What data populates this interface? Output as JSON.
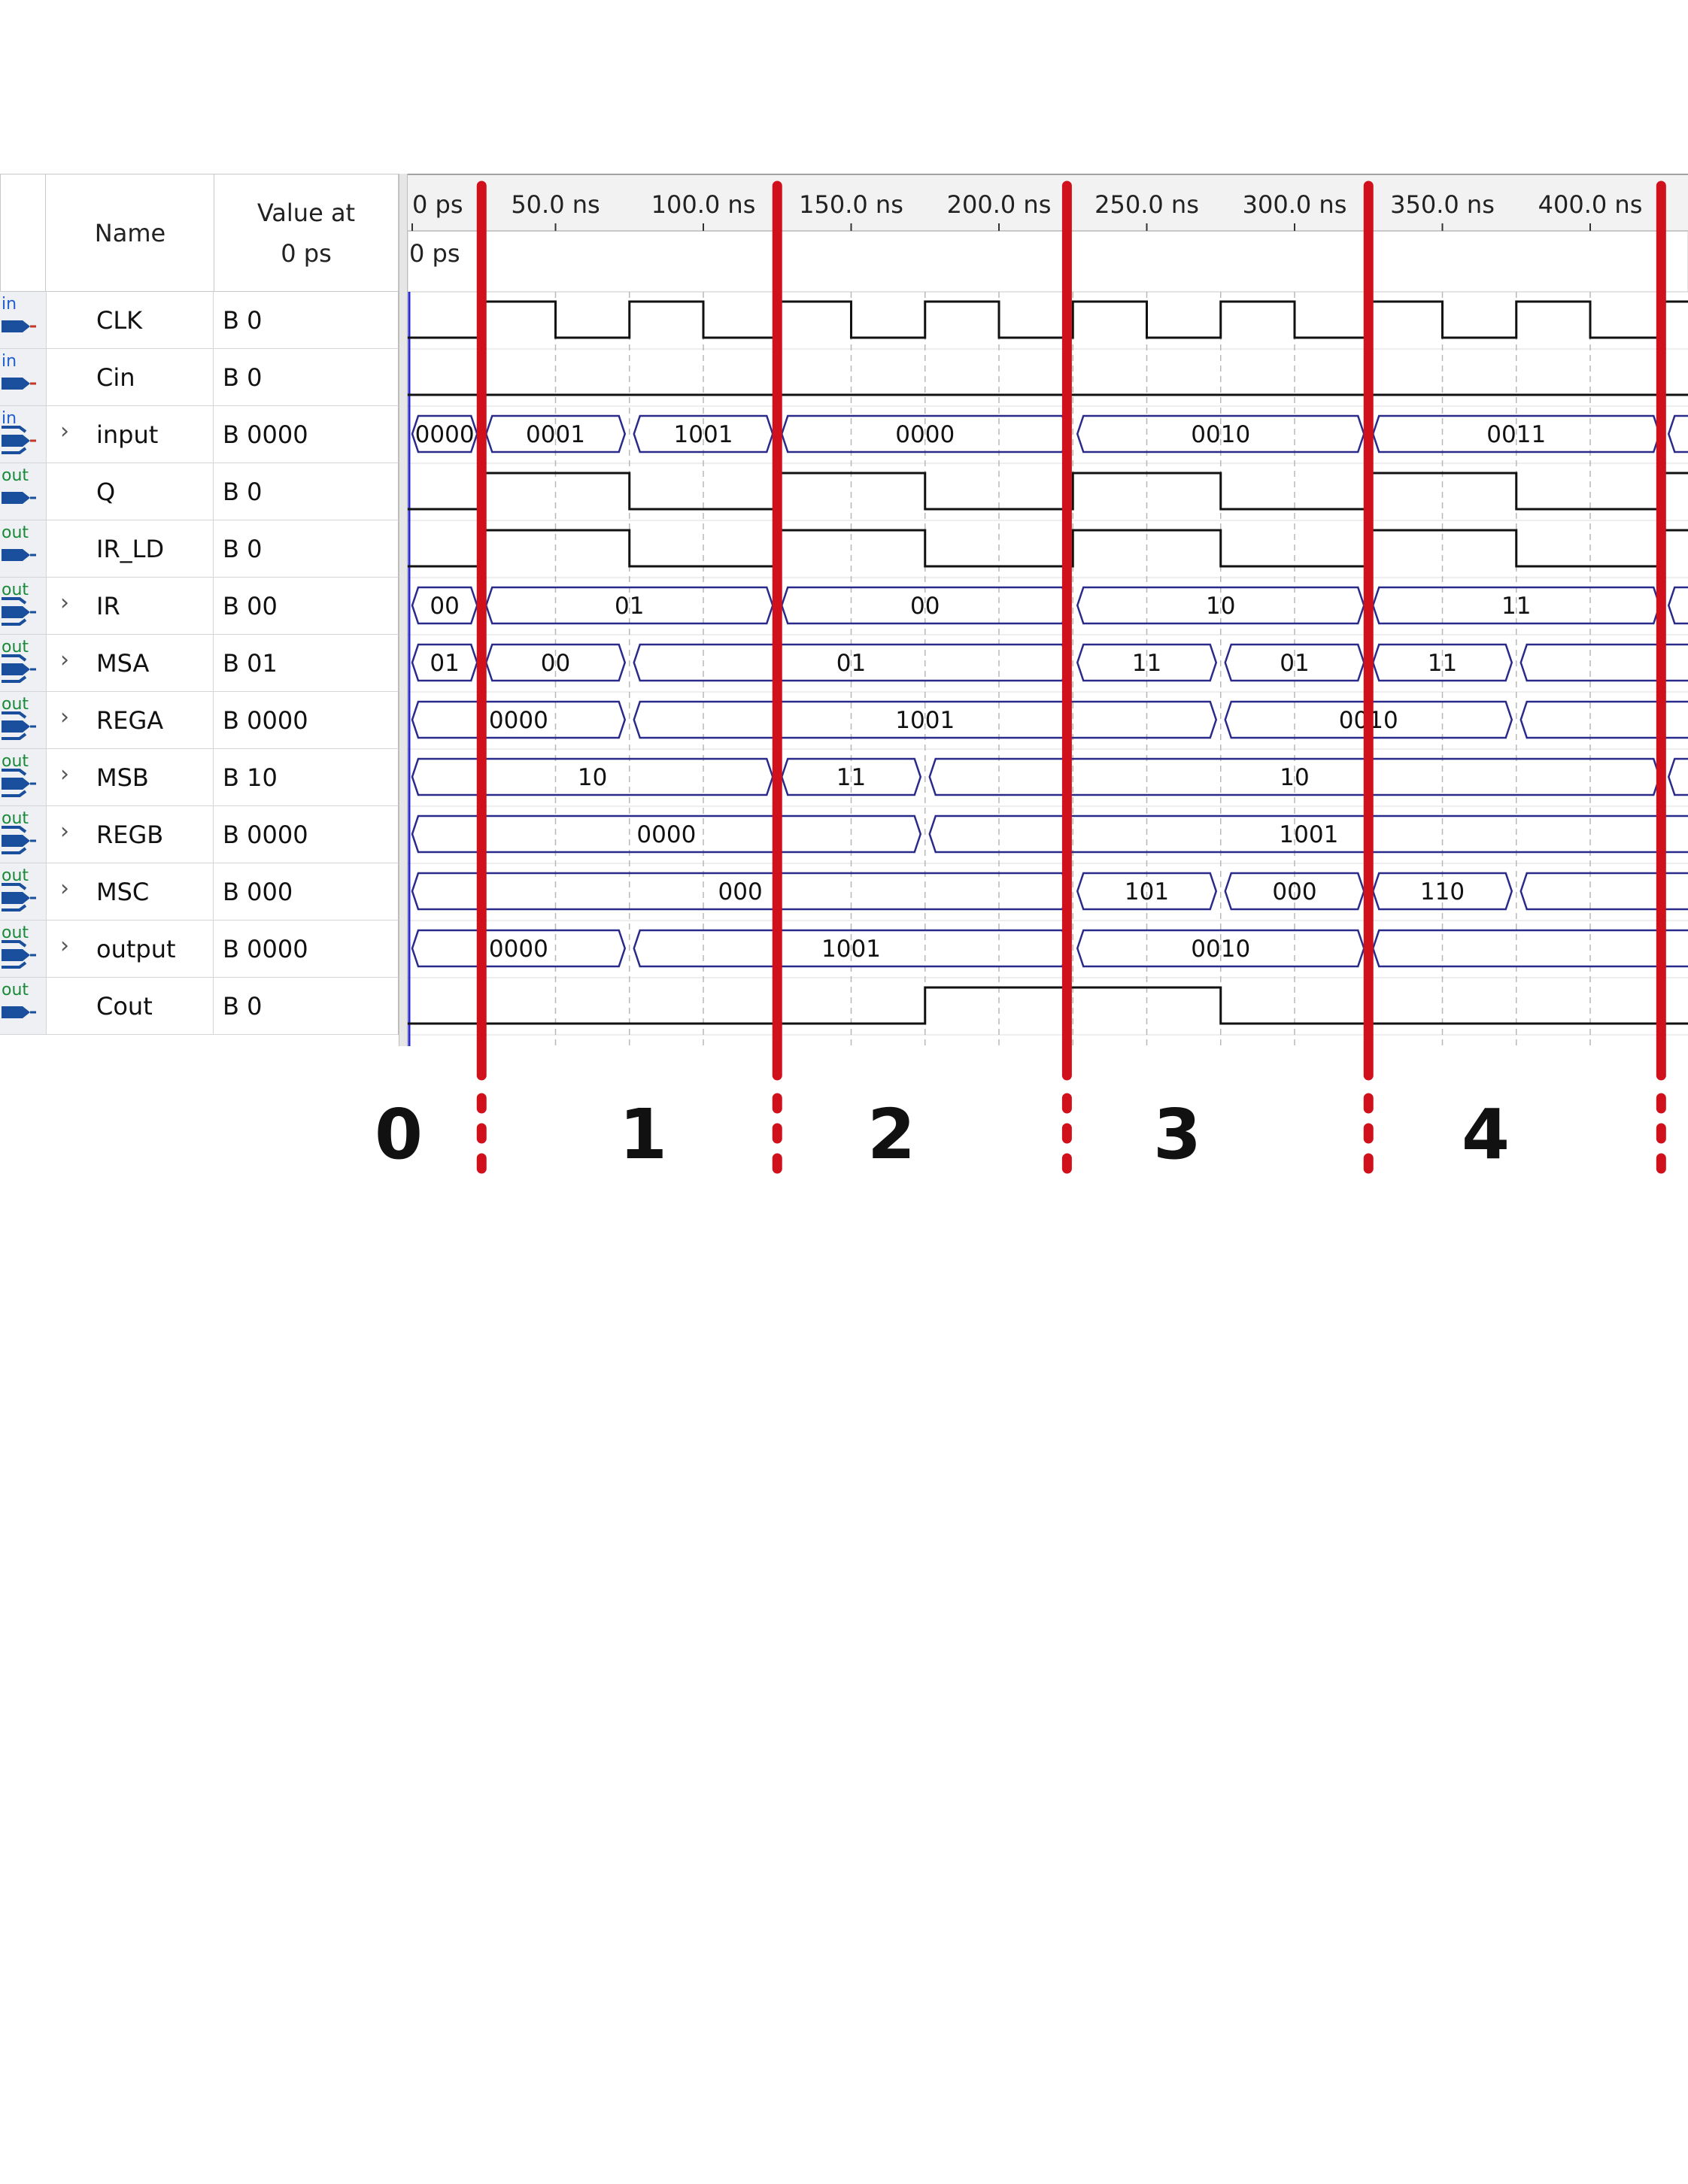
{
  "header": {
    "name_label": "Name",
    "value_label_line1": "Value at",
    "value_label_line2": "0 ps",
    "cursor_label": "0 ps"
  },
  "timeline": {
    "ticks": [
      "0 ps",
      "50.0 ns",
      "100.0 ns",
      "150.0 ns",
      "200.0 ns",
      "250.0 ns",
      "300.0 ns",
      "350.0 ns",
      "400.0 ns"
    ],
    "tick_ns": [
      0,
      50,
      100,
      150,
      200,
      250,
      300,
      350,
      400
    ]
  },
  "signals": [
    {
      "dir": "in",
      "name": "CLK",
      "value": "B 0",
      "expand": false,
      "icon": "input-pin-icon"
    },
    {
      "dir": "in",
      "name": "Cin",
      "value": "B 0",
      "expand": false,
      "icon": "input-pin-icon"
    },
    {
      "dir": "in",
      "name": "input",
      "value": "B 0000",
      "expand": true,
      "icon": "input-bus-icon"
    },
    {
      "dir": "out",
      "name": "Q",
      "value": "B 0",
      "expand": false,
      "icon": "output-pin-icon"
    },
    {
      "dir": "out",
      "name": "IR_LD",
      "value": "B 0",
      "expand": false,
      "icon": "output-pin-icon"
    },
    {
      "dir": "out",
      "name": "IR",
      "value": "B 00",
      "expand": true,
      "icon": "output-bus-icon"
    },
    {
      "dir": "out",
      "name": "MSA",
      "value": "B 01",
      "expand": true,
      "icon": "output-bus-icon"
    },
    {
      "dir": "out",
      "name": "REGA",
      "value": "B 0000",
      "expand": true,
      "icon": "output-bus-icon"
    },
    {
      "dir": "out",
      "name": "MSB",
      "value": "B 10",
      "expand": true,
      "icon": "output-bus-icon"
    },
    {
      "dir": "out",
      "name": "REGB",
      "value": "B 0000",
      "expand": true,
      "icon": "output-bus-icon"
    },
    {
      "dir": "out",
      "name": "MSC",
      "value": "B 000",
      "expand": true,
      "icon": "output-bus-icon"
    },
    {
      "dir": "out",
      "name": "output",
      "value": "B 0000",
      "expand": true,
      "icon": "output-bus-icon"
    },
    {
      "dir": "out",
      "name": "Cout",
      "value": "B 0",
      "expand": false,
      "icon": "output-pin-icon"
    }
  ],
  "waves": {
    "CLK": {
      "type": "bit",
      "edges": [
        [
          0,
          0
        ],
        [
          25,
          1
        ],
        [
          50,
          0
        ],
        [
          75,
          1
        ],
        [
          100,
          0
        ],
        [
          125,
          1
        ],
        [
          150,
          0
        ],
        [
          175,
          1
        ],
        [
          200,
          0
        ],
        [
          225,
          1
        ],
        [
          250,
          0
        ],
        [
          275,
          1
        ],
        [
          300,
          0
        ],
        [
          325,
          1
        ],
        [
          350,
          0
        ],
        [
          375,
          1
        ],
        [
          400,
          0
        ],
        [
          425,
          1
        ]
      ]
    },
    "Cin": {
      "type": "bit",
      "edges": [
        [
          0,
          0
        ]
      ]
    },
    "input": {
      "type": "bus",
      "segments": [
        [
          0,
          25,
          "0000"
        ],
        [
          25,
          75,
          "0001"
        ],
        [
          75,
          125,
          "1001"
        ],
        [
          125,
          225,
          "0000"
        ],
        [
          225,
          325,
          "0010"
        ],
        [
          325,
          425,
          "0011"
        ],
        [
          425,
          440,
          ""
        ]
      ]
    },
    "Q": {
      "type": "bit",
      "edges": [
        [
          0,
          0
        ],
        [
          25,
          1
        ],
        [
          75,
          0
        ],
        [
          125,
          1
        ],
        [
          175,
          0
        ],
        [
          225,
          1
        ],
        [
          275,
          0
        ],
        [
          325,
          1
        ],
        [
          375,
          0
        ],
        [
          425,
          1
        ]
      ]
    },
    "IR_LD": {
      "type": "bit",
      "edges": [
        [
          0,
          0
        ],
        [
          25,
          1
        ],
        [
          75,
          0
        ],
        [
          125,
          1
        ],
        [
          175,
          0
        ],
        [
          225,
          1
        ],
        [
          275,
          0
        ],
        [
          325,
          1
        ],
        [
          375,
          0
        ],
        [
          425,
          1
        ]
      ]
    },
    "IR": {
      "type": "bus",
      "segments": [
        [
          0,
          25,
          "00"
        ],
        [
          25,
          125,
          "01"
        ],
        [
          125,
          225,
          "00"
        ],
        [
          225,
          325,
          "10"
        ],
        [
          325,
          425,
          "11"
        ],
        [
          425,
          440,
          ""
        ]
      ]
    },
    "MSA": {
      "type": "bus",
      "segments": [
        [
          0,
          25,
          "01"
        ],
        [
          25,
          75,
          "00"
        ],
        [
          75,
          225,
          "01"
        ],
        [
          225,
          275,
          "11"
        ],
        [
          275,
          325,
          "01"
        ],
        [
          325,
          375,
          "11"
        ],
        [
          375,
          440,
          ""
        ]
      ]
    },
    "REGA": {
      "type": "bus",
      "segments": [
        [
          0,
          75,
          "0000"
        ],
        [
          75,
          275,
          "1001"
        ],
        [
          275,
          375,
          "0010"
        ],
        [
          375,
          440,
          ""
        ]
      ]
    },
    "MSB": {
      "type": "bus",
      "segments": [
        [
          0,
          125,
          "10"
        ],
        [
          125,
          175,
          "11"
        ],
        [
          175,
          425,
          "10"
        ],
        [
          425,
          440,
          ""
        ]
      ]
    },
    "REGB": {
      "type": "bus",
      "segments": [
        [
          0,
          175,
          "0000"
        ],
        [
          175,
          440,
          "1001"
        ]
      ]
    },
    "MSC": {
      "type": "bus",
      "segments": [
        [
          0,
          225,
          "000"
        ],
        [
          225,
          275,
          "101"
        ],
        [
          275,
          325,
          "000"
        ],
        [
          325,
          375,
          "110"
        ],
        [
          375,
          440,
          ""
        ]
      ]
    },
    "output": {
      "type": "bus",
      "segments": [
        [
          0,
          75,
          "0000"
        ],
        [
          75,
          225,
          "1001"
        ],
        [
          225,
          325,
          "0010"
        ],
        [
          325,
          440,
          ""
        ]
      ]
    },
    "Cout": {
      "type": "bit",
      "edges": [
        [
          0,
          0
        ],
        [
          175,
          1
        ],
        [
          275,
          0
        ]
      ]
    }
  },
  "annotations": {
    "marker_ns": [
      25,
      125,
      223,
      325,
      424
    ],
    "phase_labels": [
      "0",
      "1",
      "2",
      "3",
      "4"
    ],
    "marker_color": "#d0111b"
  },
  "colors": {
    "bus": "#2a2a8a",
    "bit": "#111111",
    "grid": "#b8b8b8"
  }
}
